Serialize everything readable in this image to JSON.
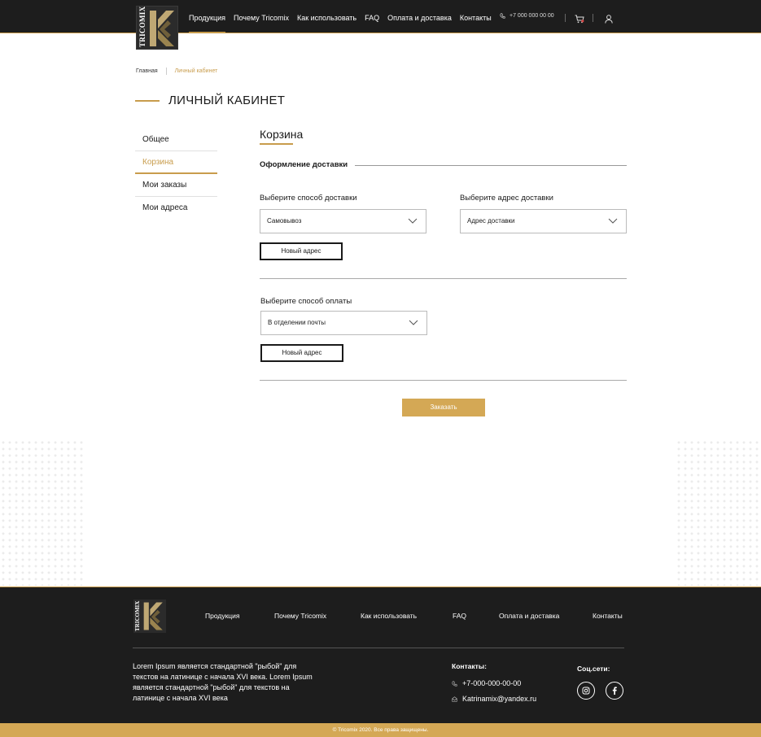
{
  "header": {
    "logo_text": "TRICOMIX",
    "nav": [
      "Продукция",
      "Почему Tricomix",
      "Как использовать",
      "FAQ",
      "Оплата и доставка",
      "Контакты"
    ],
    "phone": "+7 000 000 00 00"
  },
  "breadcrumb": {
    "home": "Главная",
    "current": "Личный кабинет"
  },
  "page_title": "ЛИЧНЫЙ КАБИНЕТ",
  "sidebar": {
    "items": [
      "Общее",
      "Корзина",
      "Мои заказы",
      "Мои адреса"
    ],
    "active": 1
  },
  "main": {
    "section_title": "Корзина",
    "subtitle": "Оформление доставки",
    "delivery_method_label": "Выберите способ доставки",
    "delivery_method_value": "Самовывоз",
    "delivery_address_label": "Выберите адрес доставки",
    "delivery_address_value": "Адрес доставки",
    "new_address_button": "Новый адрес",
    "payment_label": "Выберите способ оплаты",
    "payment_value": "В отделении почты",
    "new_address_button_2": "Новый адрес",
    "order_button": "Заказать"
  },
  "footer": {
    "logo_text": "TRICOMIX",
    "nav": [
      "Продукция",
      "Почему Tricomix",
      "Как использовать",
      "FAQ",
      "Оплата и доставка",
      "Контакты"
    ],
    "description": " Lorem Ipsum является стандартной \"рыбой\" для текстов на латинице с начала XVI века. Lorem Ipsum является стандартной \"рыбой\" для текстов на латинице с начала XVI века",
    "contacts_title": "Контакты:",
    "phone": "+7-000-000-00-00",
    "email": "Katrinamix@yandex.ru",
    "social_title": "Соц.сети:",
    "copyright": "© Tricomix 2020. Все права защищены."
  },
  "colors": {
    "accent": "#c89c4c",
    "dark": "#1d1d1d",
    "button_gold": "#d4a855"
  }
}
